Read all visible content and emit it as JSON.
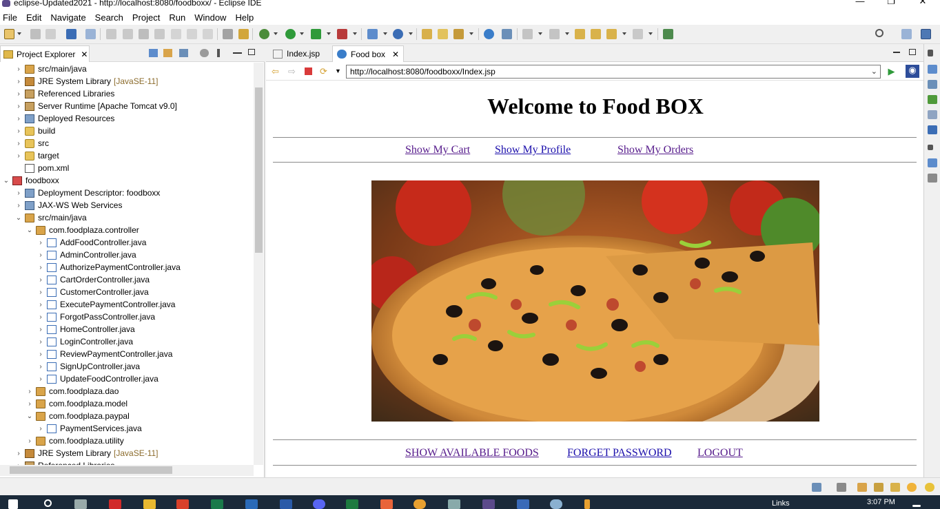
{
  "window": {
    "title": "eclipse-Updated2021 - http://localhost:8080/foodboxx/ - Eclipse IDE",
    "minimize": "—",
    "maximize": "❐",
    "close": "✕"
  },
  "menu": [
    "File",
    "Edit",
    "Navigate",
    "Search",
    "Project",
    "Run",
    "Window",
    "Help"
  ],
  "project_explorer": {
    "tab_label": "Project Explorer",
    "tree": [
      {
        "indent": 0,
        "chev": "›",
        "icon": "pkg",
        "label": "src/main/java"
      },
      {
        "indent": 0,
        "chev": "›",
        "icon": "jre",
        "label": "JRE System Library",
        "suffix": "[JavaSE-11]"
      },
      {
        "indent": 0,
        "chev": "›",
        "icon": "lib",
        "label": "Referenced Libraries"
      },
      {
        "indent": 0,
        "chev": "›",
        "icon": "lib",
        "label": "Server Runtime [Apache Tomcat v9.0]"
      },
      {
        "indent": 0,
        "chev": "›",
        "icon": "cfg",
        "label": "Deployed Resources"
      },
      {
        "indent": 0,
        "chev": "›",
        "icon": "folder",
        "label": "build"
      },
      {
        "indent": 0,
        "chev": "›",
        "icon": "folder",
        "label": "src"
      },
      {
        "indent": 0,
        "chev": "›",
        "icon": "folder",
        "label": "target"
      },
      {
        "indent": 0,
        "chev": "",
        "icon": "xml",
        "label": "pom.xml"
      },
      {
        "indent": -1,
        "chev": "⌄",
        "icon": "proj",
        "label": "foodboxx"
      },
      {
        "indent": 0,
        "chev": "›",
        "icon": "cfg",
        "label": "Deployment Descriptor: foodboxx"
      },
      {
        "indent": 0,
        "chev": "›",
        "icon": "cfg",
        "label": "JAX-WS Web Services"
      },
      {
        "indent": 0,
        "chev": "⌄",
        "icon": "pkg",
        "label": "src/main/java"
      },
      {
        "indent": 1,
        "chev": "⌄",
        "icon": "pkg",
        "label": "com.foodplaza.controller"
      },
      {
        "indent": 2,
        "chev": "›",
        "icon": "java",
        "label": "AddFoodController.java"
      },
      {
        "indent": 2,
        "chev": "›",
        "icon": "java",
        "label": "AdminController.java"
      },
      {
        "indent": 2,
        "chev": "›",
        "icon": "java",
        "label": "AuthorizePaymentController.java"
      },
      {
        "indent": 2,
        "chev": "›",
        "icon": "java",
        "label": "CartOrderController.java"
      },
      {
        "indent": 2,
        "chev": "›",
        "icon": "java",
        "label": "CustomerController.java"
      },
      {
        "indent": 2,
        "chev": "›",
        "icon": "java",
        "label": "ExecutePaymentController.java"
      },
      {
        "indent": 2,
        "chev": "›",
        "icon": "java",
        "label": "ForgotPassController.java"
      },
      {
        "indent": 2,
        "chev": "›",
        "icon": "java",
        "label": "HomeController.java"
      },
      {
        "indent": 2,
        "chev": "›",
        "icon": "java",
        "label": "LoginController.java"
      },
      {
        "indent": 2,
        "chev": "›",
        "icon": "java",
        "label": "ReviewPaymentController.java"
      },
      {
        "indent": 2,
        "chev": "›",
        "icon": "java",
        "label": "SignUpController.java"
      },
      {
        "indent": 2,
        "chev": "›",
        "icon": "java",
        "label": "UpdateFoodController.java"
      },
      {
        "indent": 1,
        "chev": "›",
        "icon": "pkg",
        "label": "com.foodplaza.dao"
      },
      {
        "indent": 1,
        "chev": "›",
        "icon": "pkg",
        "label": "com.foodplaza.model"
      },
      {
        "indent": 1,
        "chev": "⌄",
        "icon": "pkg",
        "label": "com.foodplaza.paypal"
      },
      {
        "indent": 2,
        "chev": "›",
        "icon": "java",
        "label": "PaymentServices.java"
      },
      {
        "indent": 1,
        "chev": "›",
        "icon": "pkg",
        "label": "com.foodplaza.utility"
      },
      {
        "indent": 0,
        "chev": "›",
        "icon": "jre",
        "label": "JRE System Library",
        "suffix": "[JavaSE-11]"
      },
      {
        "indent": 0,
        "chev": "›",
        "icon": "lib",
        "label": "Referenced Libraries"
      }
    ]
  },
  "editor": {
    "tabs": [
      {
        "label": "Index.jsp",
        "active": false
      },
      {
        "label": "Food box",
        "active": true
      }
    ],
    "url": "http://localhost:8080/foodboxx/Index.jsp"
  },
  "webpage": {
    "heading": "Welcome to Food BOX",
    "top_links": [
      "Show My Cart",
      "Show My Profile",
      "Show My Orders"
    ],
    "bottom_links": [
      "SHOW AVAILABLE FOODS",
      "FORGET PASSWORD",
      "LOGOUT"
    ]
  },
  "taskbar": {
    "time": "3:07 PM",
    "links_label": "Links"
  },
  "colors": {
    "link_visited": "#551a8b",
    "link_unvisited": "#1a0dab",
    "taskbar": "#1b2a3a"
  }
}
